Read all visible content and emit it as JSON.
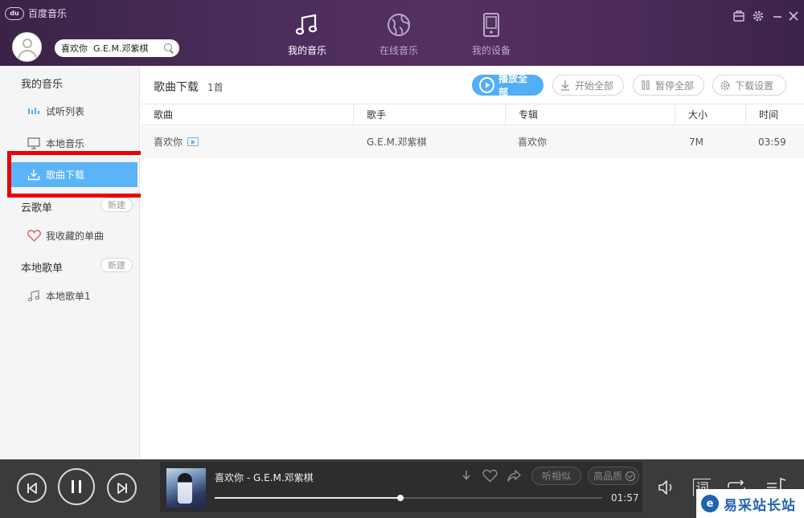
{
  "app": {
    "title": "百度音乐",
    "logo_text": "du"
  },
  "search": {
    "value": "喜欢你  G.E.M.邓紫棋"
  },
  "nav": {
    "my_music": "我的音乐",
    "online_music": "在线音乐",
    "my_device": "我的设备"
  },
  "sidebar": {
    "my_music_section": "我的音乐",
    "items": [
      {
        "label": "试听列表",
        "icon": "bars-icon"
      },
      {
        "label": "本地音乐",
        "icon": "monitor-icon"
      },
      {
        "label": "歌曲下载",
        "icon": "download-icon"
      }
    ],
    "cloud_section": "云歌单",
    "cloud_new": "新建",
    "cloud_items": [
      {
        "label": "我收藏的单曲",
        "icon": "heart-icon"
      }
    ],
    "local_section": "本地歌单",
    "local_new": "新建",
    "local_items": [
      {
        "label": "本地歌单1",
        "icon": "music-note-icon"
      }
    ]
  },
  "main": {
    "title": "歌曲下载",
    "count": "1首",
    "toolbar": {
      "play_all": "播放全部",
      "start_all": "开始全部",
      "pause_all": "暂停全部",
      "download_settings": "下载设置"
    },
    "columns": [
      "歌曲",
      "歌手",
      "专辑",
      "大小",
      "时间"
    ],
    "rows": [
      {
        "song": "喜欢你",
        "singer": "G.E.M.邓紫棋",
        "album": "喜欢你",
        "size": "7M",
        "time": "03:59"
      }
    ]
  },
  "player": {
    "track": "喜欢你 - G.E.M.邓紫棋",
    "similar": "听相似",
    "quality": "高品质",
    "elapsed": "01:57",
    "progress": 0.48,
    "lyrics_label": "词"
  },
  "watermark": {
    "text": "易采站长站",
    "logo": "e"
  },
  "colors": {
    "accent": "#52aef5",
    "header": "#4a2c5a",
    "player_bg": "#3b3b3d",
    "highlight": "#ee0000"
  }
}
